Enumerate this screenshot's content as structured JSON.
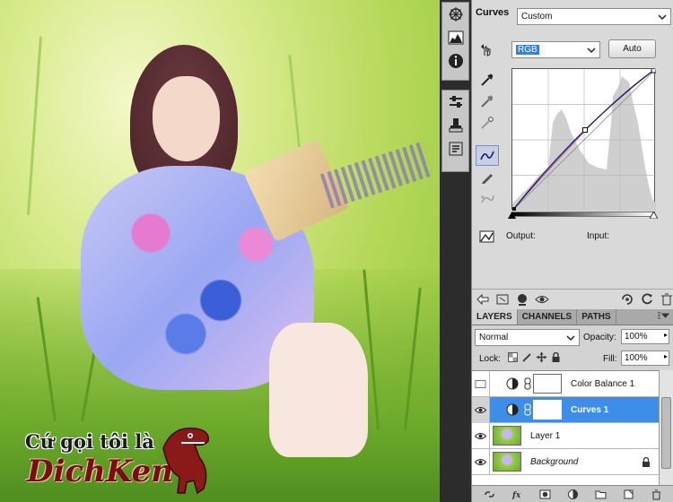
{
  "watermark": {
    "line1": "Cứ gọi tôi là",
    "line2": "DichKen"
  },
  "toolstrip": {
    "icons": [
      "navigator-icon",
      "histogram-icon",
      "info-icon",
      "adjustments-icon",
      "clone-source-icon",
      "actions-icon"
    ]
  },
  "adjustments": {
    "title": "Curves",
    "preset_value": "Custom",
    "channel_value": "RGB",
    "auto_label": "Auto",
    "output_label": "Output:",
    "input_label": "Input:"
  },
  "layers_panel": {
    "tabs": [
      "LAYERS",
      "CHANNELS",
      "PATHS"
    ],
    "active_tab": "LAYERS",
    "blend_mode": "Normal",
    "opacity_label": "Opacity:",
    "opacity_value": "100%",
    "lock_label": "Lock:",
    "fill_label": "Fill:",
    "fill_value": "100%",
    "layers": [
      {
        "name": "Color Balance 1",
        "type": "adjustment",
        "visible": false,
        "selected": false
      },
      {
        "name": "Curves 1",
        "type": "adjustment",
        "visible": true,
        "selected": true
      },
      {
        "name": "Layer 1",
        "type": "pixel",
        "visible": true,
        "selected": false
      },
      {
        "name": "Background",
        "type": "pixel",
        "visible": true,
        "selected": false,
        "locked": true
      }
    ]
  },
  "colors": {
    "selection": "#3d8ee8",
    "panel_bg": "#d9d9d9",
    "curve_line": "#1a1a6e",
    "watermark_red": "#7a0c14"
  }
}
